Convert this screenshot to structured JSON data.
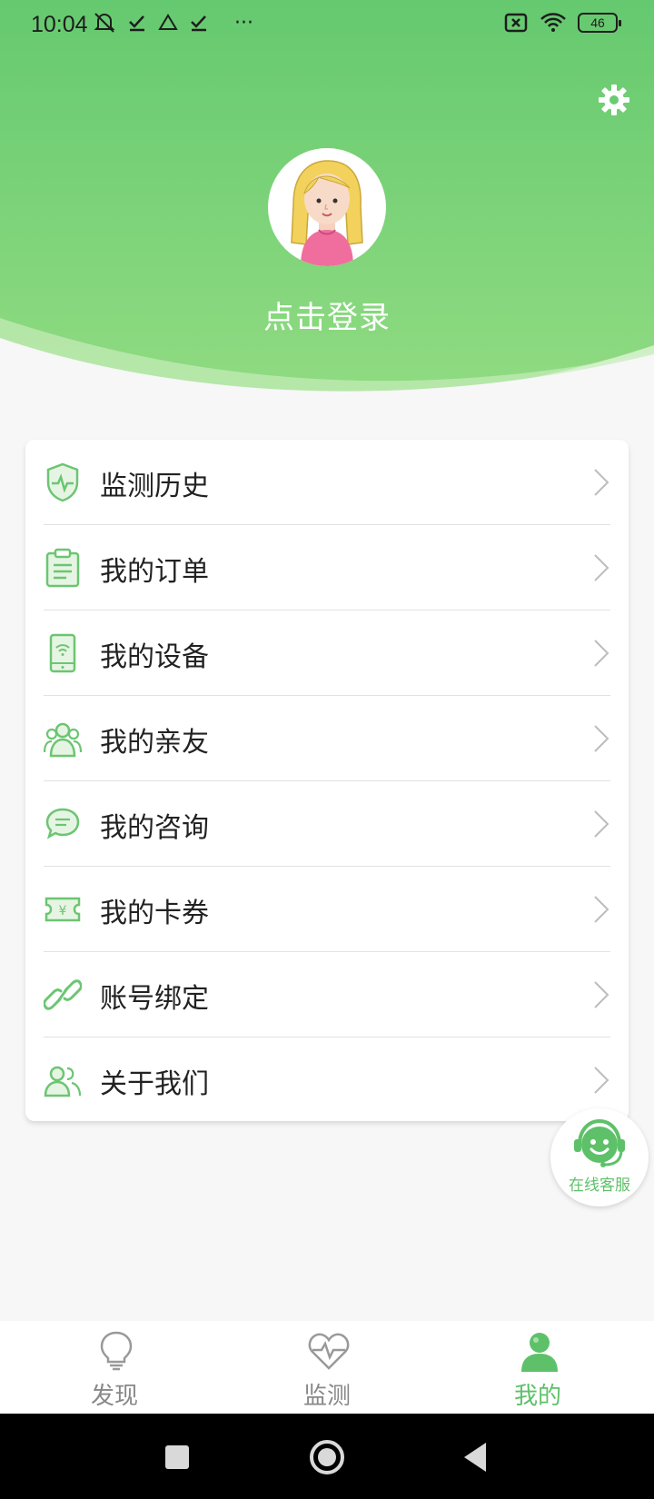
{
  "status_bar": {
    "time": "10:04",
    "more": "···",
    "battery": "46"
  },
  "profile": {
    "login_prompt": "点击登录"
  },
  "menu": {
    "items": [
      {
        "label": "监测历史",
        "icon": "shield-heartbeat-icon"
      },
      {
        "label": "我的订单",
        "icon": "clipboard-icon"
      },
      {
        "label": "我的设备",
        "icon": "phone-wifi-icon"
      },
      {
        "label": "我的亲友",
        "icon": "people-icon"
      },
      {
        "label": "我的咨询",
        "icon": "chat-bubble-icon"
      },
      {
        "label": "我的卡券",
        "icon": "coupon-icon"
      },
      {
        "label": "账号绑定",
        "icon": "link-icon"
      },
      {
        "label": "关于我们",
        "icon": "users-icon"
      }
    ]
  },
  "support": {
    "label": "在线客服"
  },
  "tabbar": {
    "tabs": [
      {
        "label": "发现",
        "icon": "lightbulb-icon",
        "active": false
      },
      {
        "label": "监测",
        "icon": "heart-pulse-icon",
        "active": false
      },
      {
        "label": "我的",
        "icon": "person-icon",
        "active": true
      }
    ]
  },
  "colors": {
    "accent": "#5ec16a",
    "header_top": "#65c96f",
    "header_bottom": "#93dc83"
  }
}
